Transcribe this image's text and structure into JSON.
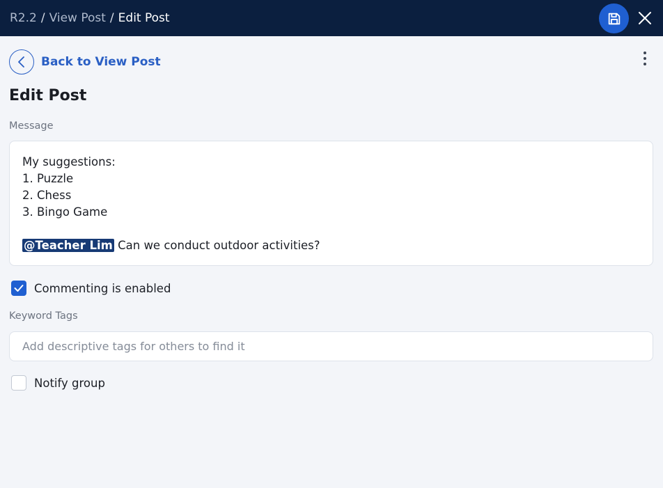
{
  "header": {
    "breadcrumb": [
      "R2.2",
      "View Post",
      "Edit Post"
    ],
    "separator": "/",
    "save_icon": "save-icon",
    "close_icon": "close-icon"
  },
  "back": {
    "label": "Back to View Post",
    "icon": "chevron-left-icon"
  },
  "more_icon": "more-vertical-icon",
  "page_title": "Edit Post",
  "message": {
    "label": "Message",
    "lines": [
      "My suggestions:",
      "1. Puzzle",
      "2. Chess",
      "3. Bingo Game",
      ""
    ],
    "mention": "@Teacher Lim",
    "mention_text": " Can we conduct outdoor activities?"
  },
  "commenting": {
    "label": "Commenting is enabled",
    "checked": true
  },
  "tags": {
    "label": "Keyword Tags",
    "placeholder": "Add descriptive tags for others to find it",
    "value": ""
  },
  "notify": {
    "label": "Notify group",
    "checked": false
  },
  "colors": {
    "header_bg": "#0b1f3f",
    "accent": "#1f5fd1",
    "mention_bg": "#173a75"
  }
}
